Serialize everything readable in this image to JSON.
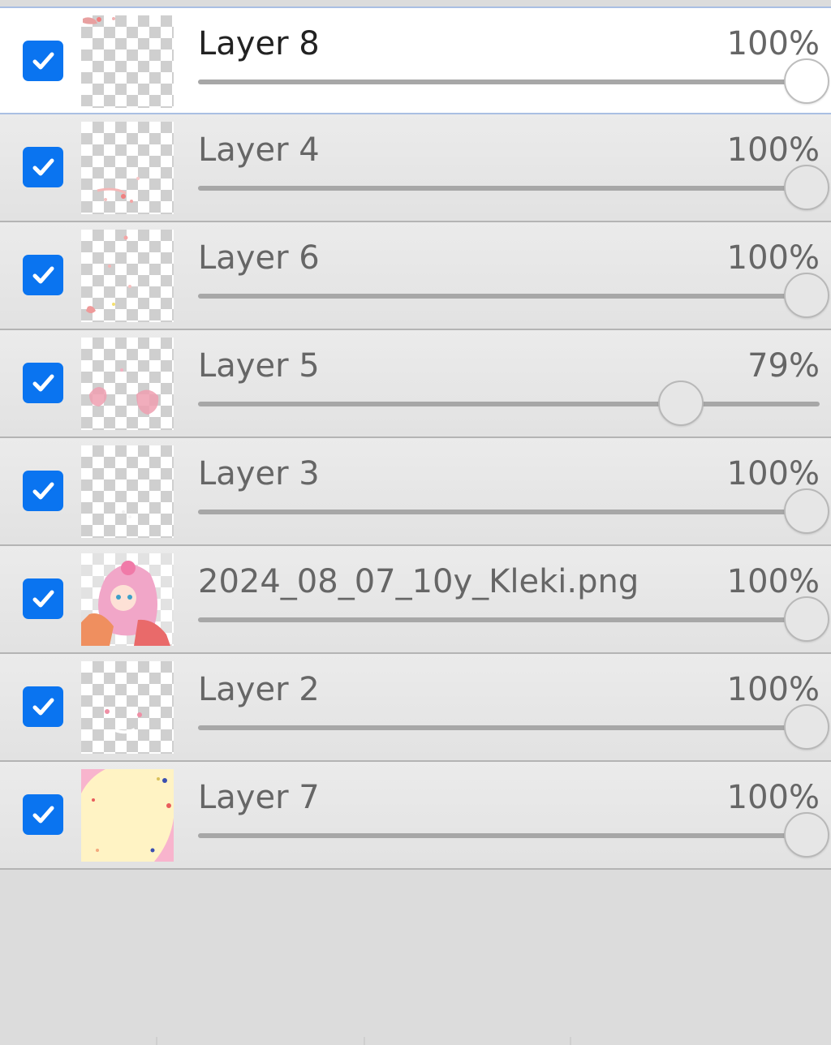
{
  "layers": [
    {
      "name": "Layer 8",
      "opacity": "100%",
      "value": 1.0,
      "selected": true,
      "visible": true,
      "thumb": "layer8"
    },
    {
      "name": "Layer 4",
      "opacity": "100%",
      "value": 1.0,
      "selected": false,
      "visible": true,
      "thumb": "layer4"
    },
    {
      "name": "Layer 6",
      "opacity": "100%",
      "value": 1.0,
      "selected": false,
      "visible": true,
      "thumb": "layer6"
    },
    {
      "name": "Layer 5",
      "opacity": "79%",
      "value": 0.79,
      "selected": false,
      "visible": true,
      "thumb": "layer5"
    },
    {
      "name": "Layer 3",
      "opacity": "100%",
      "value": 1.0,
      "selected": false,
      "visible": true,
      "thumb": "layer3"
    },
    {
      "name": "2024_08_07_10y_Kleki.png",
      "opacity": "100%",
      "value": 1.0,
      "selected": false,
      "visible": true,
      "thumb": "kleki"
    },
    {
      "name": "Layer 2",
      "opacity": "100%",
      "value": 1.0,
      "selected": false,
      "visible": true,
      "thumb": "layer2"
    },
    {
      "name": "Layer 7",
      "opacity": "100%",
      "value": 1.0,
      "selected": false,
      "visible": true,
      "thumb": "layer7"
    }
  ],
  "colors": {
    "checkbox": "#0a74f0",
    "selected_bg": "#ffffff",
    "row_bg": "#e4e4e4",
    "panel_bg": "#dcdcdc"
  },
  "icons": {
    "checkbox": "checkmark-icon"
  }
}
